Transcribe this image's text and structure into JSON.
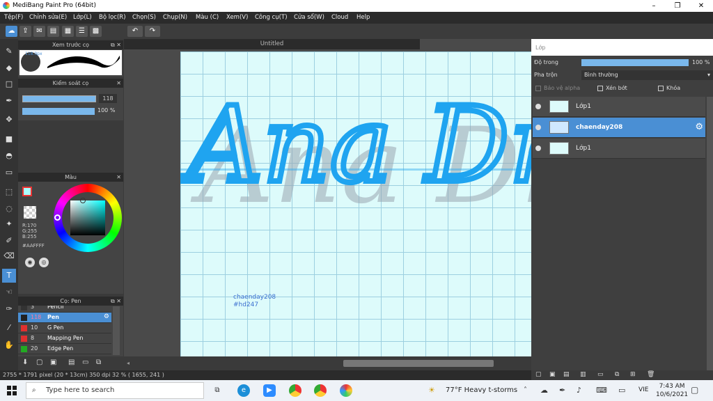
{
  "window": {
    "title": "MediBang Paint Pro (64bit)",
    "minimize": "–",
    "maximize": "❐",
    "close": "✕"
  },
  "menu": [
    "Tệp(F)",
    "Chỉnh sửa(E)",
    "Lớp(L)",
    "Bộ lọc(R)",
    "Chọn(S)",
    "Chụp(N)",
    "Màu (C)",
    "Xem(V)",
    "Công cụ(T)",
    "Cửa sổ(W)",
    "Cloud",
    "Help"
  ],
  "brush_preview": {
    "title": "Xem trước cọ",
    "size_label": "118.0px"
  },
  "brush_control": {
    "title": "Kiểm soát cọ",
    "size_value": "118",
    "opacity_value": "100 %"
  },
  "color": {
    "title": "Màu",
    "r": "R:170",
    "g": "G:255",
    "b": "B:255",
    "hex": "#AAFFFF",
    "accent": "#4a8fd4"
  },
  "brush_list": {
    "title": "Cọ: Pen",
    "items": [
      {
        "size": "3",
        "name": "Pencil",
        "color": "#333333"
      },
      {
        "size": "118",
        "name": "Pen",
        "color": "#222222"
      },
      {
        "size": "10",
        "name": "G Pen",
        "color": "#e03030"
      },
      {
        "size": "8",
        "name": "Mapping Pen",
        "color": "#e03030"
      },
      {
        "size": "20",
        "name": "Edge Pen",
        "color": "#22aa22"
      }
    ]
  },
  "canvas": {
    "tab": "Untitled",
    "art_text": "Ana Dr",
    "signature_line1": "chaenday208",
    "signature_line2": "#hd247"
  },
  "layers_panel": {
    "title": "Lớp",
    "opacity_label": "Độ trong",
    "opacity_value": "100 %",
    "opacity_fraction": 1.0,
    "blend_label": "Pha trộn",
    "blend_value": "Bình thường",
    "protect_alpha": "Bảo vệ alpha",
    "clipping": "Xén bớt",
    "lock": "Khóa",
    "layers": [
      {
        "name": "Lớp1",
        "selected": false
      },
      {
        "name": "chaenday208",
        "selected": true
      },
      {
        "name": "Lớp1",
        "selected": false
      }
    ]
  },
  "status": {
    "text": "2755 * 1791 pixel  (20 * 13cm)  350 dpi  32 %  ( 1655, 241 )"
  },
  "taskbar": {
    "search_placeholder": "Type here to search",
    "weather": "77°F  Heavy t-storms",
    "lang": "VIE",
    "time": "7:43 AM",
    "date": "10/6/2021"
  }
}
